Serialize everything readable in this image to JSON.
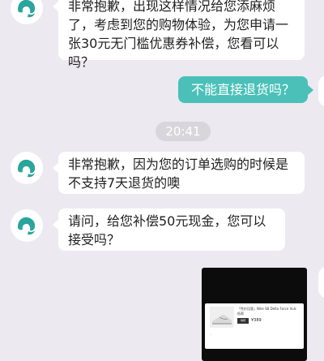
{
  "messages": [
    {
      "sender": "agent",
      "text": "非常抱歉，出现这样情况给您添麻烦了，考虑到您的购物体验，为您申请一张30元无门槛优惠券补偿，您看可以吗？"
    },
    {
      "sender": "user",
      "text": "不能直接退货吗？"
    },
    {
      "sender": "agent",
      "text": "非常抱歉，因为您的订单选购的时候是不支持7天退货的噢"
    },
    {
      "sender": "agent",
      "text": "请问，给您补偿50元现金，您可以接受吗？"
    }
  ],
  "timestamp": "20:41",
  "product_card": {
    "title": "「性价比版」Nike SB Delta Force Vulc 低帮",
    "tag": "球鞋",
    "price": "¥389",
    "desc": "..."
  },
  "colors": {
    "background": "#ece9f0",
    "agent_bubble": "#ffffff",
    "user_bubble": "#4bc0b8",
    "avatar_accent": "#2aa59c"
  },
  "icons": {
    "agent_avatar": "support-agent-logo-icon"
  }
}
